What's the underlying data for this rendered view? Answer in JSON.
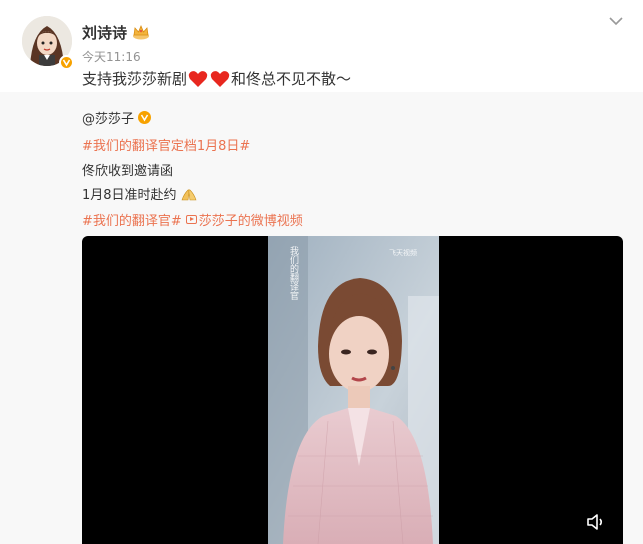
{
  "post": {
    "author": "刘诗诗",
    "time": "今天11:16",
    "text_before": "支持我莎莎新剧",
    "text_after": "和佟总不见不散～"
  },
  "repost": {
    "original_author": "@莎莎子",
    "hashtag1": "#我们的翻译官定档1月8日#",
    "line1": "佟欣收到邀请函",
    "line2": "1月8日准时赴约",
    "hashtag2": "#我们的翻译官#",
    "video_link": "莎莎子的微博视频"
  },
  "video": {
    "watermark": "飞天视频",
    "title_art": "我们的翻译官"
  },
  "icons": {
    "verified": "verified-badge-icon",
    "crown": "crown-icon",
    "heart": "red-heart-emoji",
    "pray": "folded-hands-emoji",
    "volume": "volume-icon",
    "more": "chevron-down-icon"
  },
  "colors": {
    "hashtag": "#eb7350",
    "verified": "#f7a200",
    "heart": "#e8271f"
  }
}
